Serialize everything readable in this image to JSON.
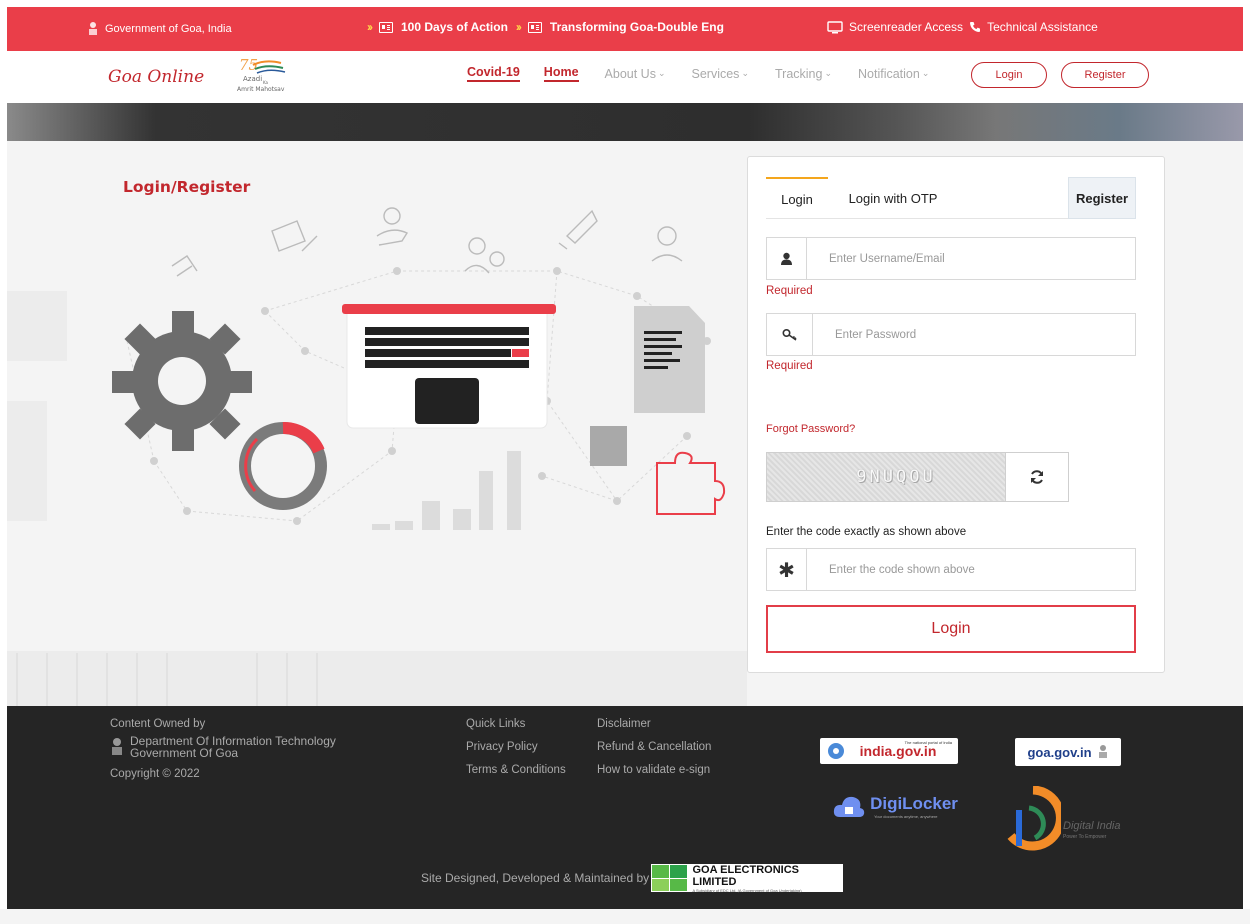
{
  "topbar": {
    "govt_label": "Government of Goa, India",
    "marquee_1": "100 Days of Action",
    "marquee_2": "Transforming Goa-Double Eng",
    "screenreader": "Screenreader Access",
    "tech_assist": "Technical Assistance"
  },
  "nav": {
    "logo": "Goa Online",
    "azadi_1": "Azadi",
    "azadi_2": "Ka",
    "azadi_3": "Amrit Mahotsav",
    "items": [
      "Covid-19",
      "Home",
      "About Us",
      "Services",
      "Tracking",
      "Notification"
    ],
    "login": "Login",
    "register": "Register"
  },
  "page": {
    "title": "Login/Register"
  },
  "login_panel": {
    "tabs": [
      "Login",
      "Login with OTP",
      "Register"
    ],
    "username_placeholder": "Enter Username/Email",
    "username_error": "Required",
    "password_placeholder": "Enter Password",
    "password_error": "Required",
    "forgot": "Forgot Password?",
    "captcha_text": "9NUQOU",
    "code_hint": "Enter the code exactly as shown above",
    "code_placeholder": "Enter the code shown above",
    "submit": "Login"
  },
  "footer": {
    "owned": "Content Owned by",
    "dept_1": "Department Of Information Technology",
    "dept_2": "Government Of Goa",
    "copyright": "Copyright © 2022",
    "links": [
      "Quick Links",
      "Privacy Policy",
      "Terms & Conditions",
      "Disclaimer",
      "Refund & Cancellation",
      "How to validate e-sign"
    ],
    "india_portal": "india.gov.in",
    "india_tag": "The national portal of India",
    "goa_gov": "goa.gov.in",
    "digilocker": "DigiLocker",
    "digilocker_tag": "Your documents anytime, anywhere",
    "digital_india": "Digital India",
    "digital_india_tag": "Power To Empower",
    "site_by": "Site Designed, Developed & Maintained by",
    "gel_name": "GOA ELECTRONICS LIMITED",
    "gel_sub": "A Subsidiary of EDC Ltd. (A Government of Goa Undertaking)"
  },
  "colors": {
    "brand_red": "#ea3e49",
    "accent_red": "#c2272d",
    "footer_bg": "#252525",
    "tab_accent": "#f4a61d"
  }
}
